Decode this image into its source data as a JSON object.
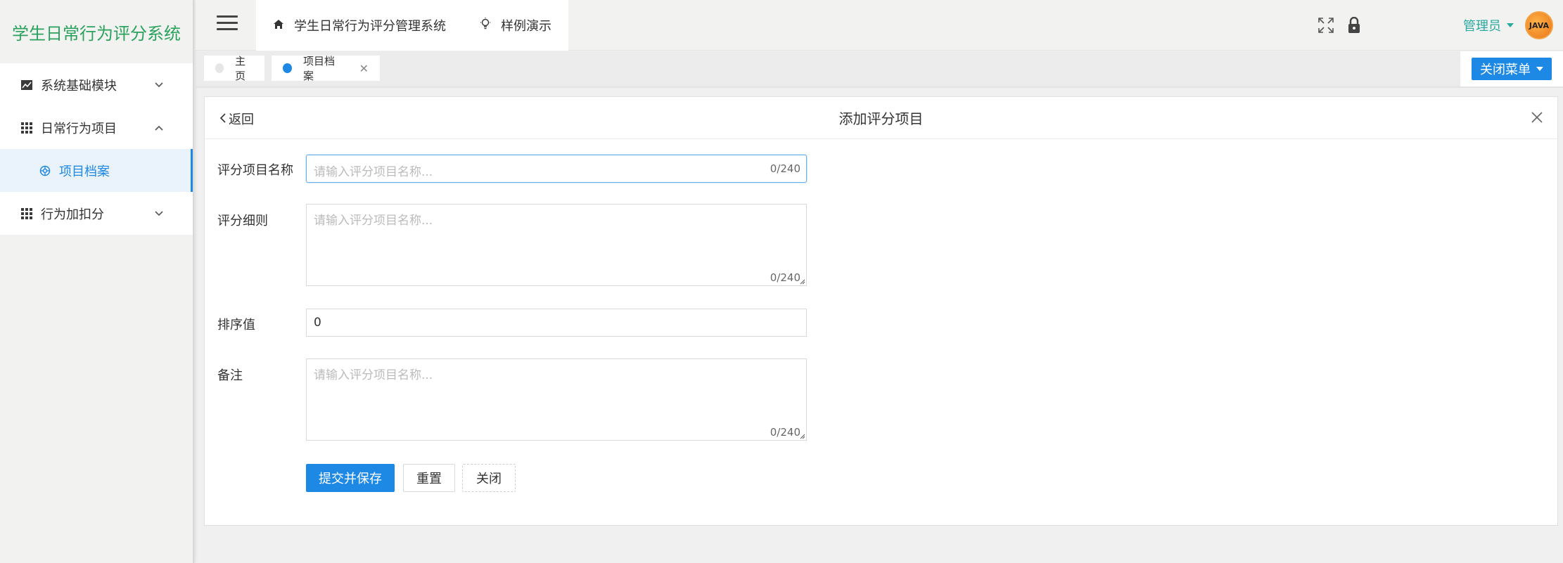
{
  "sidebar": {
    "logo": "学生日常行为评分系统",
    "items": [
      {
        "label": "系统基础模块",
        "icon": "chart-icon"
      },
      {
        "label": "日常行为项目",
        "icon": "grid-icon"
      },
      {
        "label": "项目档案",
        "icon": "circle-gear-icon"
      },
      {
        "label": "行为加扣分",
        "icon": "grid-icon"
      }
    ]
  },
  "topbar": {
    "nav": [
      {
        "label": "学生日常行为评分管理系统",
        "icon": "home-icon"
      },
      {
        "label": "样例演示",
        "icon": "bulb-icon"
      }
    ],
    "admin_label": "管理员",
    "avatar_text": "JAVA"
  },
  "tabs": {
    "items": [
      {
        "label": "主页"
      },
      {
        "label": "项目档案"
      }
    ],
    "close_menu_label": "关闭菜单"
  },
  "form": {
    "back_label": "返回",
    "title": "添加评分项目",
    "fields": [
      {
        "label": "评分项目名称",
        "placeholder": "请输入评分项目名称...",
        "count": "0/240"
      },
      {
        "label": "评分细则",
        "placeholder": "请输入评分项目名称...",
        "count": "0/240"
      },
      {
        "label": "排序值",
        "value": "0"
      },
      {
        "label": "备注",
        "placeholder": "请输入评分项目名称...",
        "count": "0/240"
      }
    ],
    "buttons": {
      "submit": "提交并保存",
      "reset": "重置",
      "close": "关闭"
    }
  },
  "colors": {
    "accent": "#1e88e5",
    "logo_green": "#2aa25e",
    "admin_teal": "#29a8a0"
  }
}
